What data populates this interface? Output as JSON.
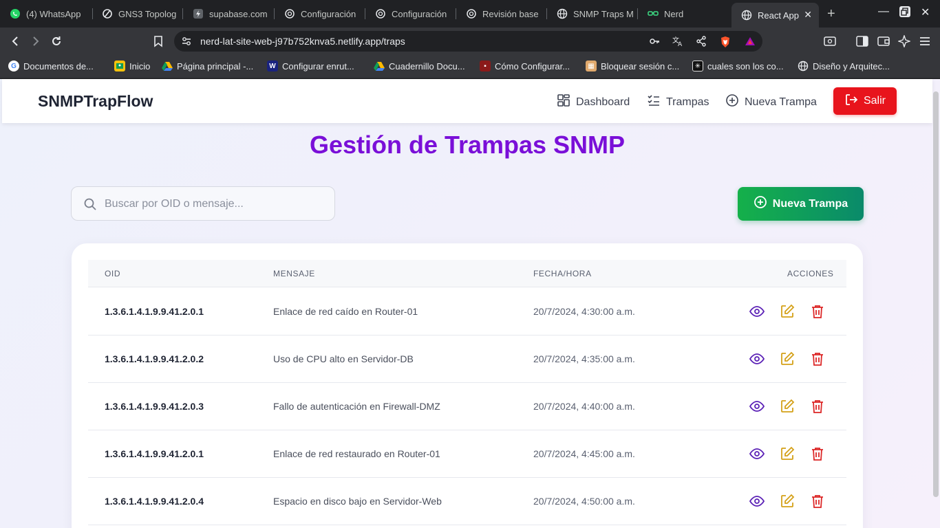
{
  "browser": {
    "tabs": [
      {
        "label": "(4) WhatsApp",
        "icon": "whatsapp-icon"
      },
      {
        "label": "GNS3 Topolog",
        "icon": "gns3-icon"
      },
      {
        "label": "supabase.com",
        "icon": "supabase-icon"
      },
      {
        "label": "Configuración",
        "icon": "chatgpt-icon"
      },
      {
        "label": "Configuración",
        "icon": "chatgpt-icon"
      },
      {
        "label": "Revisión base",
        "icon": "chatgpt-icon"
      },
      {
        "label": "SNMP Traps M",
        "icon": "globe-icon"
      },
      {
        "label": "Nerd",
        "icon": "glasses-icon"
      },
      {
        "label": "React App",
        "icon": "globe-icon",
        "active": true
      }
    ],
    "url": "nerd-lat-site-web-j97b752knva5.netlify.app/traps",
    "bookmarks": [
      {
        "label": "Documentos de...",
        "icon": "google-icon"
      },
      {
        "label": "Inicio",
        "icon": "classroom-icon"
      },
      {
        "label": "Página principal -...",
        "icon": "drive-icon"
      },
      {
        "label": "Configurar enrut...",
        "icon": "doc-icon"
      },
      {
        "label": "Cuadernillo Docu...",
        "icon": "drive-icon"
      },
      {
        "label": "Cómo Configurar...",
        "icon": "cisco-icon"
      },
      {
        "label": "Bloquear sesión c...",
        "icon": "blocks-icon"
      },
      {
        "label": "cuales son los co...",
        "icon": "pixel-icon"
      },
      {
        "label": "Diseño y Arquitec...",
        "icon": "globe-icon"
      }
    ]
  },
  "app": {
    "brand": "SNMPTrapFlow",
    "nav": {
      "dashboard": "Dashboard",
      "traps": "Trampas",
      "new_trap": "Nueva Trampa",
      "logout": "Salir"
    },
    "page_title": "Gestión de Trampas SNMP",
    "search": {
      "placeholder": "Buscar por OID o mensaje...",
      "value": ""
    },
    "new_button": "Nueva Trampa",
    "table": {
      "headers": {
        "oid": "OID",
        "message": "MENSAJE",
        "datetime": "FECHA/HORA",
        "actions": "ACCIONES"
      },
      "rows": [
        {
          "oid": "1.3.6.1.4.1.9.9.41.2.0.1",
          "message": "Enlace de red caído en Router-01",
          "datetime": "20/7/2024, 4:30:00 a.m."
        },
        {
          "oid": "1.3.6.1.4.1.9.9.41.2.0.2",
          "message": "Uso de CPU alto en Servidor-DB",
          "datetime": "20/7/2024, 4:35:00 a.m."
        },
        {
          "oid": "1.3.6.1.4.1.9.9.41.2.0.3",
          "message": "Fallo de autenticación en Firewall-DMZ",
          "datetime": "20/7/2024, 4:40:00 a.m."
        },
        {
          "oid": "1.3.6.1.4.1.9.9.41.2.0.1",
          "message": "Enlace de red restaurado en Router-01",
          "datetime": "20/7/2024, 4:45:00 a.m."
        },
        {
          "oid": "1.3.6.1.4.1.9.9.41.2.0.4",
          "message": "Espacio en disco bajo en Servidor-Web",
          "datetime": "20/7/2024, 4:50:00 a.m."
        }
      ]
    },
    "colors": {
      "title": "#7a0fd8",
      "logout": "#e8141c",
      "new_button": "#15b04a",
      "view_icon": "#5b21b6",
      "edit_icon": "#d4a017",
      "delete_icon": "#dc2626"
    }
  }
}
